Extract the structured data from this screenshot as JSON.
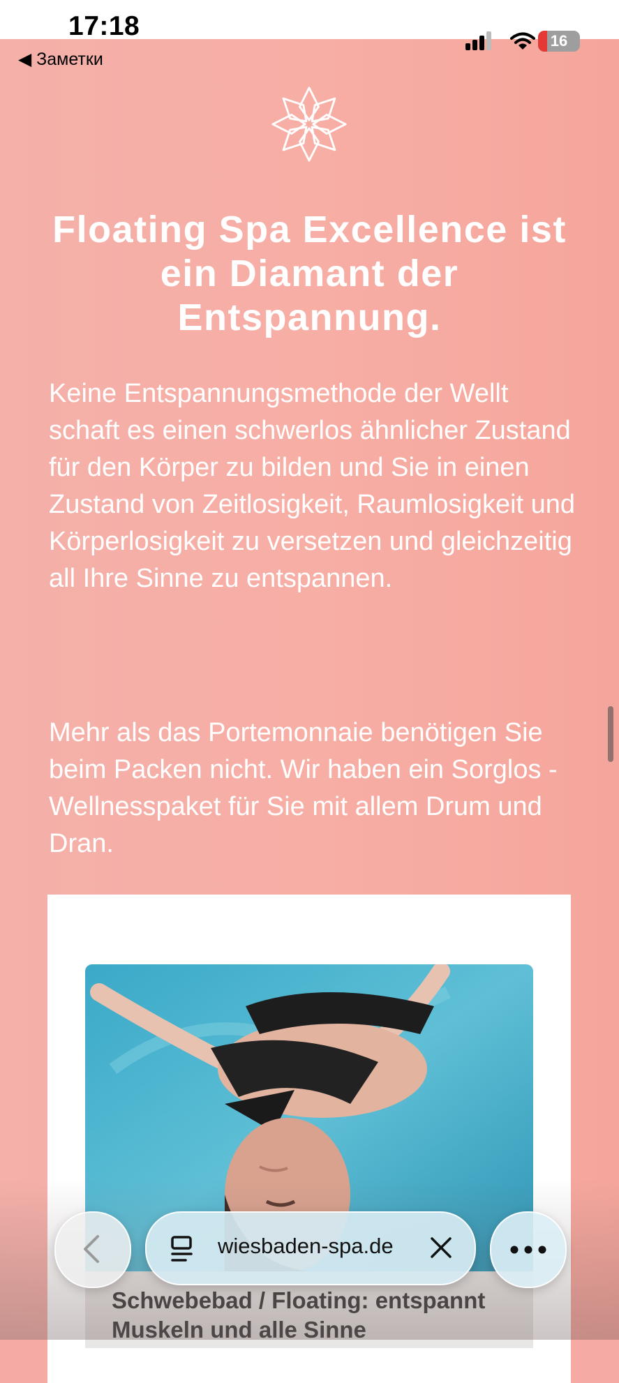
{
  "status_bar": {
    "time": "17:18",
    "back_app": "◀ Заметки",
    "battery": "16"
  },
  "content": {
    "headline": "Floating Spa Excellence ist ein Diamant der Entspannung.",
    "paragraph_1": "Keine Entspannungsmethode der Wellt schaft es einen schwerlos ähnlicher Zustand für den Körper zu bilden und Sie in einen Zustand von Zeitlosigkeit, Raumlosigkeit und Körperlosigkeit zu versetzen und gleichzeitig all Ihre Sinne zu entspannen.",
    "paragraph_2": "Mehr als das Portemonnaie benötigen Sie beim Packen nicht. Wir haben ein Sorglos - Wellnesspaket für Sie mit allem Drum und Dran.",
    "card_caption": "Schwebebad / Floating: entspannt Muskeln und alle Sinne"
  },
  "browser": {
    "url": "wiesbaden-spa.de"
  },
  "colors": {
    "background": "#f5aaa3",
    "accent_battery": "#e53935"
  }
}
